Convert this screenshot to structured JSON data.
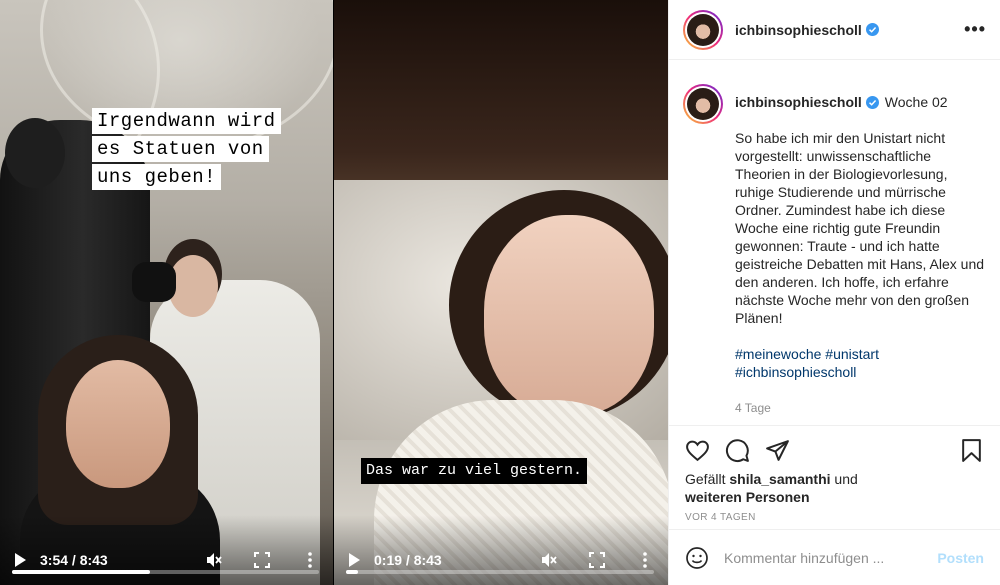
{
  "colors": {
    "verified": "#3897f0",
    "link": "#00376b",
    "muted": "#8e8e8e",
    "post_button": "#b2dffc"
  },
  "videos": [
    {
      "caption_lines": [
        "Irgendwann wird",
        "es Statuen von",
        "uns geben!"
      ],
      "time": "3:54 / 8:43",
      "progress": 0.45
    },
    {
      "caption_lines": [
        "Das war zu viel gestern."
      ],
      "time": "0:19 / 8:43",
      "progress": 0.04
    }
  ],
  "icons": {
    "play": "play-icon",
    "mute": "muted-speaker-icon",
    "fullscreen": "fullscreen-icon",
    "menu": "vertical-dots-icon"
  },
  "panel": {
    "header": {
      "username": "ichbinsophiescholl",
      "more": "•••"
    },
    "post": {
      "username": "ichbinsophiescholl",
      "title": "Woche 02",
      "body": "So habe ich mir den Unistart nicht vorgestellt: unwissenschaftliche Theorien in der Biologievorlesung, ruhige Studierende und mürrische Ordner. Zumindest habe ich diese Woche eine richtig gute Freundin gewonnen: Traute - und ich hatte geistreiche Debatten mit Hans, Alex und den anderen. Ich hoffe, ich erfahre nächste Woche mehr von den großen Plänen!",
      "hashtags": [
        "#meinewoche",
        "#unistart",
        "#ichbinsophiescholl"
      ],
      "ago": "4 Tage"
    },
    "likes": {
      "prefix": "Gefällt",
      "user": "shila_samanthi",
      "middle": "und",
      "others": "weiteren Personen"
    },
    "date": "VOR 4 TAGEN",
    "comment": {
      "placeholder": "Kommentar hinzufügen ...",
      "post_label": "Posten"
    }
  }
}
